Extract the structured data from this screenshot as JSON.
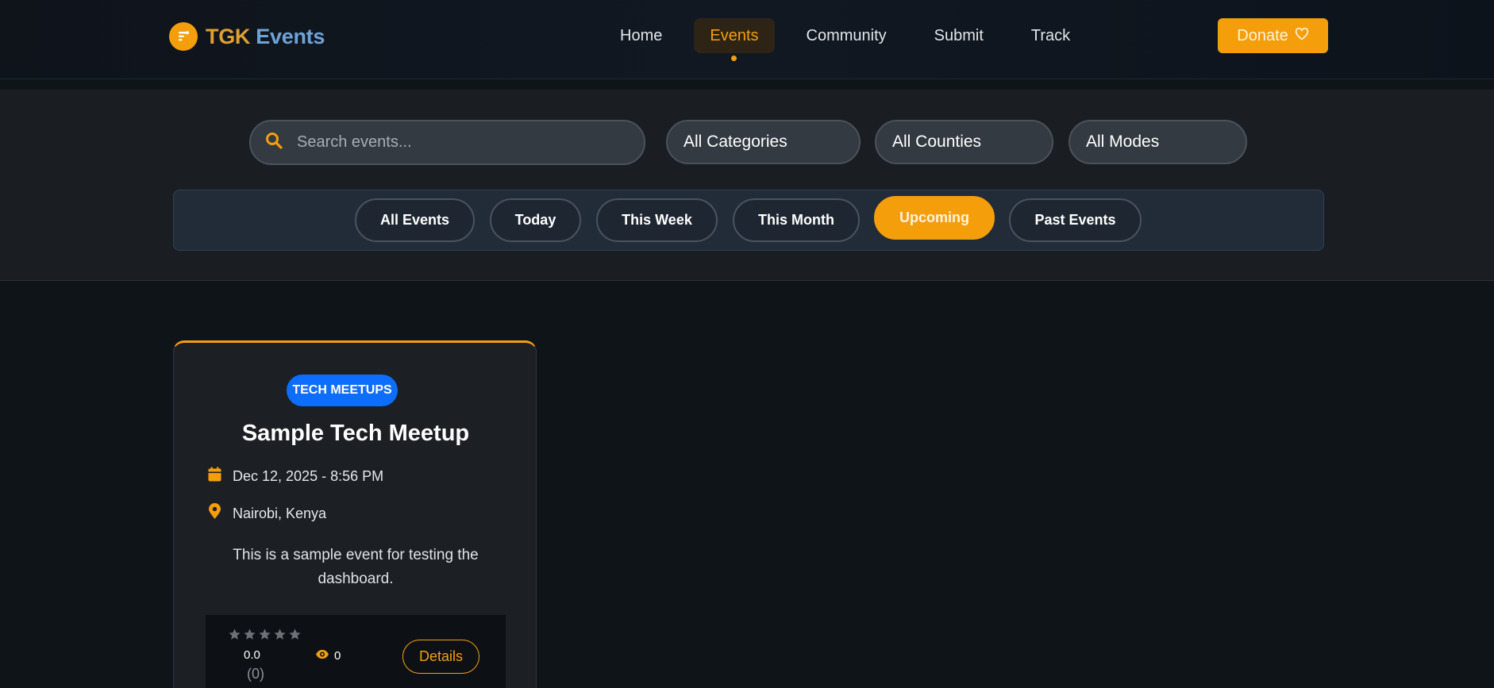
{
  "brand": {
    "name_part1": "TGK",
    "name_part2": "Events",
    "accent": "#f59e0b"
  },
  "nav": {
    "items": [
      {
        "label": "Home"
      },
      {
        "label": "Events",
        "active": true
      },
      {
        "label": "Community"
      },
      {
        "label": "Submit"
      },
      {
        "label": "Track"
      }
    ],
    "donate_label": "Donate"
  },
  "filters": {
    "search_placeholder": "Search events...",
    "category": "All Categories",
    "county": "All Counties",
    "mode": "All Modes"
  },
  "date_tabs": [
    {
      "label": "All Events"
    },
    {
      "label": "Today"
    },
    {
      "label": "This Week"
    },
    {
      "label": "This Month"
    },
    {
      "label": "Upcoming",
      "active": true
    },
    {
      "label": "Past Events"
    }
  ],
  "events": [
    {
      "category": "TECH MEETUPS",
      "category_color": "#0d6efd",
      "title": "Sample Tech Meetup",
      "datetime": "Dec 12, 2025 - 8:56 PM",
      "location": "Nairobi, Kenya",
      "description": "This is a sample event for testing the dashboard.",
      "rating": "0.0",
      "rating_count": "(0)",
      "views": "0",
      "details_label": "Details"
    }
  ]
}
